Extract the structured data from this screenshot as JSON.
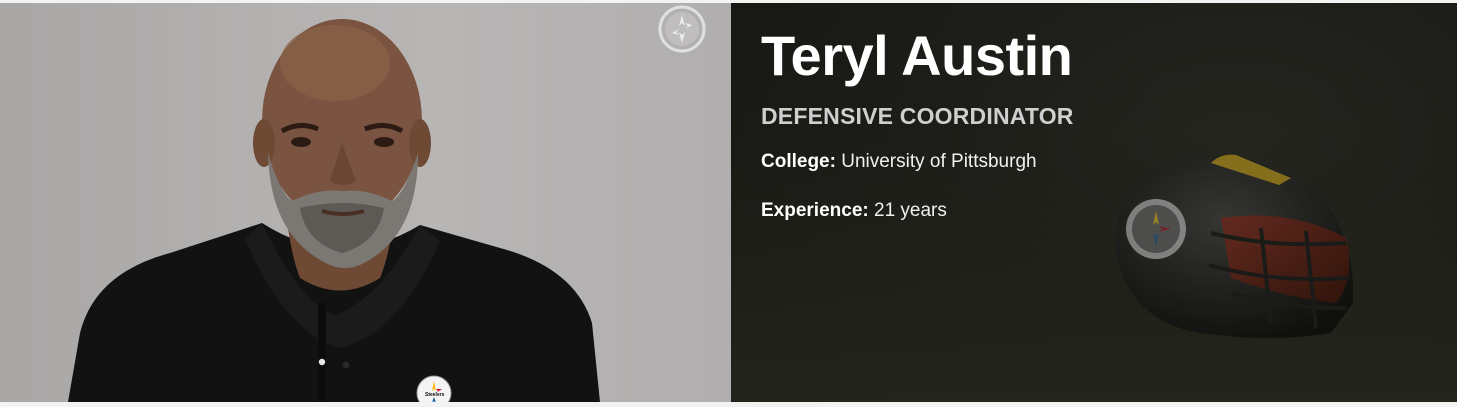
{
  "coach": {
    "name": "Teryl Austin",
    "position": "DEFENSIVE COORDINATOR",
    "details": [
      {
        "label": "College:",
        "value": "University of Pittsburgh"
      },
      {
        "label": "Experience:",
        "value": "21 years"
      }
    ]
  },
  "photo": {
    "subject": "coach-headshot",
    "watermark_icon": "steelers-logo-icon",
    "shirt_logo_icon": "steelers-logo-icon",
    "shirt_logo_text": "Steelers"
  },
  "background": {
    "subject": "football-helmet-on-field",
    "helmet_logo_icon": "steelers-logo-icon"
  },
  "colors": {
    "info_panel_bg": "#1a1a16",
    "photo_bg": "#b1afae",
    "title_gray": "#cfcfcf",
    "steelers_yellow": "#ffb612",
    "steelers_red": "#c60c30",
    "steelers_blue": "#00539b"
  }
}
